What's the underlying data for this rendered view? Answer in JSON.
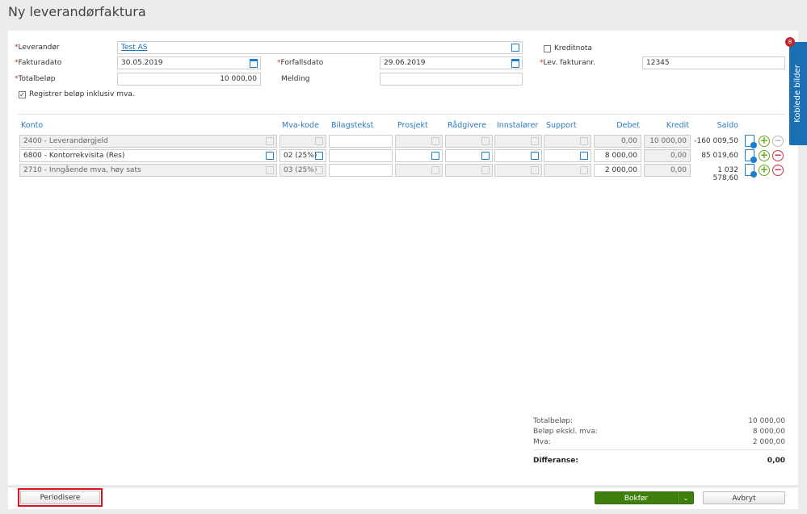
{
  "title": "Ny leverandørfaktura",
  "form": {
    "leverandor_label": "Leverandør",
    "leverandor_value": "Test AS",
    "fakturadato_label": "Fakturadato",
    "fakturadato_value": "30.05.2019",
    "forfallsdato_label": "Forfallsdato",
    "forfallsdato_value": "29.06.2019",
    "totalbelop_label": "Totalbeløp",
    "totalbelop_value": "10 000,00",
    "melding_label": "Melding",
    "melding_value": "",
    "kreditnota_label": "Kreditnota",
    "kreditnota_checked": false,
    "levfakturanr_label": "Lev. fakturanr.",
    "levfakturanr_value": "12345",
    "inkl_mva_label": "Registrer beløp inklusiv mva.",
    "inkl_mva_checked": true,
    "required_mark": "*"
  },
  "side_tab": {
    "label": "Koblede bilder",
    "badge": "8"
  },
  "table": {
    "headers": [
      "Konto",
      "Mva-kode",
      "Bilagstekst",
      "Prosjekt",
      "Rådgivere",
      "Innstalører",
      "Support",
      "Debet",
      "Kredit",
      "Saldo"
    ],
    "rows": [
      {
        "konto": "2400 - Leverandørgjeld",
        "mva": "",
        "debet": "0,00",
        "kredit": "10 000,00",
        "saldo": "-160 009,50",
        "editable": false
      },
      {
        "konto": "6800 - Kontorrekvisita (Res)",
        "mva": "02 (25%)",
        "debet": "8 000,00",
        "kredit": "0,00",
        "saldo": "85 019,60",
        "editable": true
      },
      {
        "konto": "2710 - Inngående mva, høy sats",
        "mva": "03 (25%)",
        "debet": "2 000,00",
        "kredit": "0,00",
        "saldo": "1 032 578,60",
        "editable": false
      }
    ]
  },
  "summary": {
    "totalbelop_label": "Totalbeløp:",
    "totalbelop_value": "10 000,00",
    "ekskl_label": "Beløp ekskl. mva:",
    "ekskl_value": "8 000,00",
    "mva_label": "Mva:",
    "mva_value": "2 000,00",
    "differanse_label": "Differanse:",
    "differanse_value": "0,00"
  },
  "footer": {
    "periodisere": "Periodisere",
    "bokfor": "Bokfør",
    "avbryt": "Avbryt"
  },
  "colors": {
    "accent": "#1a6fb5",
    "green": "#3f7f0e",
    "highlight": "#e0101e"
  }
}
